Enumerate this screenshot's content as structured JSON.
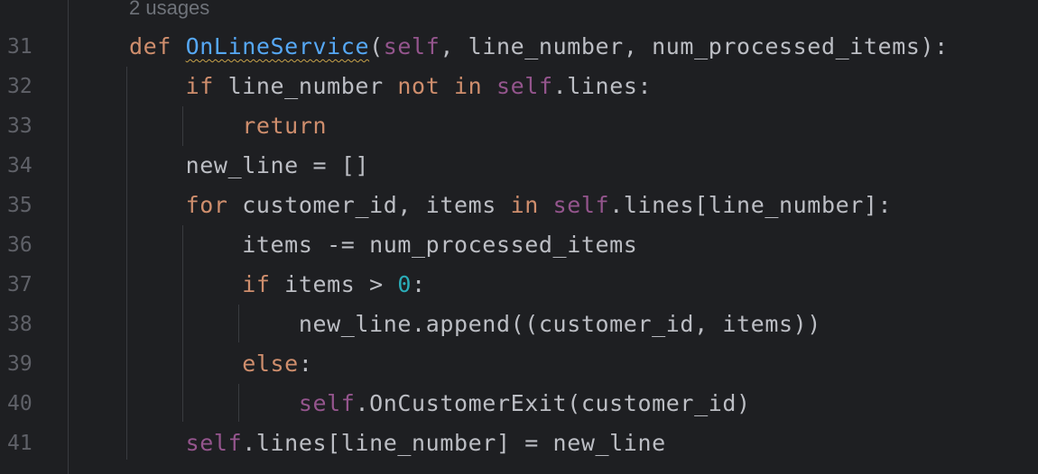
{
  "editor": {
    "usage_hint": "2 usages",
    "line_numbers": [
      "31",
      "32",
      "33",
      "34",
      "35",
      "36",
      "37",
      "38",
      "39",
      "40",
      "41"
    ],
    "lines": [
      {
        "indent": "",
        "tokens": [
          {
            "t": "def",
            "c": "kw"
          },
          {
            "t": " "
          },
          {
            "t": "OnLineService",
            "c": "fn"
          },
          {
            "t": "("
          },
          {
            "t": "self",
            "c": "slf"
          },
          {
            "t": ", line_number, num_processed_items):"
          }
        ]
      },
      {
        "indent": "    ",
        "tokens": [
          {
            "t": "if",
            "c": "kw"
          },
          {
            "t": " line_number "
          },
          {
            "t": "not",
            "c": "kw"
          },
          {
            "t": " "
          },
          {
            "t": "in",
            "c": "kw"
          },
          {
            "t": " "
          },
          {
            "t": "self",
            "c": "slf"
          },
          {
            "t": ".lines:"
          }
        ]
      },
      {
        "indent": "        ",
        "tokens": [
          {
            "t": "return",
            "c": "kw"
          }
        ]
      },
      {
        "indent": "    ",
        "tokens": [
          {
            "t": "new_line = []"
          }
        ]
      },
      {
        "indent": "    ",
        "tokens": [
          {
            "t": "for",
            "c": "kw"
          },
          {
            "t": " customer_id, items "
          },
          {
            "t": "in",
            "c": "kw"
          },
          {
            "t": " "
          },
          {
            "t": "self",
            "c": "slf"
          },
          {
            "t": ".lines[line_number]:"
          }
        ]
      },
      {
        "indent": "        ",
        "tokens": [
          {
            "t": "items -= num_processed_items"
          }
        ]
      },
      {
        "indent": "        ",
        "tokens": [
          {
            "t": "if",
            "c": "kw"
          },
          {
            "t": " items > "
          },
          {
            "t": "0",
            "c": "num"
          },
          {
            "t": ":"
          }
        ]
      },
      {
        "indent": "            ",
        "tokens": [
          {
            "t": "new_line.append((customer_id, items))"
          }
        ]
      },
      {
        "indent": "        ",
        "tokens": [
          {
            "t": "else",
            "c": "kw"
          },
          {
            "t": ":"
          }
        ]
      },
      {
        "indent": "            ",
        "tokens": [
          {
            "t": "self",
            "c": "slf"
          },
          {
            "t": ".OnCustomerExit(customer_id)"
          }
        ]
      },
      {
        "indent": "    ",
        "tokens": [
          {
            "t": "self",
            "c": "slf"
          },
          {
            "t": ".lines[line_number] = new_line"
          }
        ]
      }
    ]
  },
  "colors": {
    "background": "#1e1f22",
    "keyword": "#cf8e6d",
    "self": "#94558d",
    "function": "#56a8f5",
    "number": "#2aacb8",
    "text": "#bcbec4",
    "line_number": "#5f6168"
  }
}
